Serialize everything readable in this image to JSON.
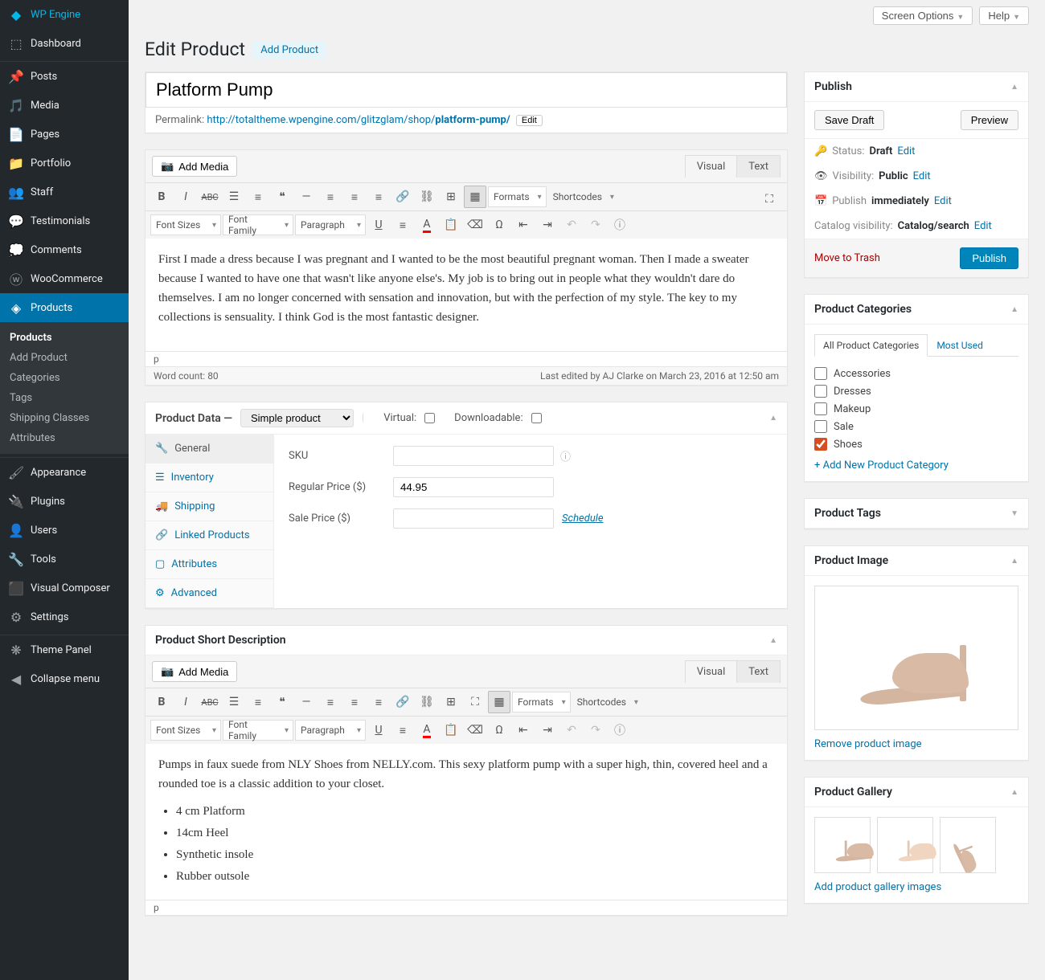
{
  "topbar": {
    "screen_options": "Screen Options",
    "help": "Help"
  },
  "page": {
    "title": "Edit Product",
    "action": "Add Product"
  },
  "sidebar": {
    "items": [
      {
        "label": "WP Engine",
        "icon": "wpengine"
      },
      {
        "label": "Dashboard",
        "icon": "dashboard"
      },
      {
        "sep": true
      },
      {
        "label": "Posts",
        "icon": "pin"
      },
      {
        "label": "Media",
        "icon": "media"
      },
      {
        "label": "Pages",
        "icon": "page"
      },
      {
        "label": "Portfolio",
        "icon": "portfolio"
      },
      {
        "label": "Staff",
        "icon": "staff"
      },
      {
        "label": "Testimonials",
        "icon": "chat"
      },
      {
        "label": "Comments",
        "icon": "comment"
      },
      {
        "label": "WooCommerce",
        "icon": "woo"
      },
      {
        "label": "Products",
        "icon": "products",
        "active": true
      },
      {
        "sep": true
      },
      {
        "label": "Appearance",
        "icon": "brush"
      },
      {
        "label": "Plugins",
        "icon": "plug"
      },
      {
        "label": "Users",
        "icon": "user"
      },
      {
        "label": "Tools",
        "icon": "tools"
      },
      {
        "label": "Visual Composer",
        "icon": "vc"
      },
      {
        "label": "Settings",
        "icon": "settings"
      },
      {
        "sep": true
      },
      {
        "label": "Theme Panel",
        "icon": "gear"
      },
      {
        "label": "Collapse menu",
        "icon": "collapse"
      }
    ],
    "submenu": [
      "Products",
      "Add Product",
      "Categories",
      "Tags",
      "Shipping Classes",
      "Attributes"
    ]
  },
  "product": {
    "title": "Platform Pump",
    "permalink_label": "Permalink:",
    "permalink_base": "http://totaltheme.wpengine.com/glitzglam/shop/",
    "permalink_slug": "platform-pump/",
    "edit": "Edit"
  },
  "editor": {
    "add_media": "Add Media",
    "tabs": {
      "visual": "Visual",
      "text": "Text"
    },
    "toolbar": {
      "formats": "Formats",
      "shortcodes": "Shortcodes",
      "font_sizes": "Font Sizes",
      "font_family": "Font Family",
      "paragraph": "Paragraph"
    },
    "body": "First I made a dress because I was pregnant and I wanted to be the most beautiful pregnant woman. Then I made a sweater because I wanted to have one that wasn't like anyone else's. My job is to bring out in people what they wouldn't dare do themselves. I am no longer concerned with sensation and innovation, but with the perfection of my style. The key to my collections is sensuality. I think God is the most fantastic designer.",
    "path": "p",
    "word_count_label": "Word count: ",
    "word_count": "80",
    "last_edited": "Last edited by AJ Clarke on March 23, 2016 at 12:50 am"
  },
  "product_data": {
    "heading": "Product Data —",
    "type": "Simple product",
    "virtual": "Virtual:",
    "downloadable": "Downloadable:",
    "tabs": [
      "General",
      "Inventory",
      "Shipping",
      "Linked Products",
      "Attributes",
      "Advanced"
    ],
    "fields": {
      "sku": "SKU",
      "sku_value": "",
      "regular": "Regular Price ($)",
      "regular_value": "44.95",
      "sale": "Sale Price ($)",
      "sale_value": "",
      "schedule": "Schedule"
    }
  },
  "short_desc": {
    "heading": "Product Short Description",
    "intro": "Pumps in faux suede from NLY Shoes from NELLY.com. This sexy platform pump with a super high, thin, covered heel and a rounded toe is a classic addition to your closet.",
    "bullets": [
      "4 cm Platform",
      "14cm Heel",
      "Synthetic insole",
      "Rubber outsole"
    ],
    "path": "p"
  },
  "publish": {
    "heading": "Publish",
    "save_draft": "Save Draft",
    "preview": "Preview",
    "status_label": "Status:",
    "status": "Draft",
    "visibility_label": "Visibility:",
    "visibility": "Public",
    "publish_label": "Publish",
    "publish_val": "immediately",
    "catalog_label": "Catalog visibility:",
    "catalog": "Catalog/search",
    "edit": "Edit",
    "trash": "Move to Trash",
    "submit": "Publish"
  },
  "categories": {
    "heading": "Product Categories",
    "tab_all": "All Product Categories",
    "tab_used": "Most Used",
    "items": [
      {
        "label": "Accessories",
        "checked": false
      },
      {
        "label": "Dresses",
        "checked": false
      },
      {
        "label": "Makeup",
        "checked": false
      },
      {
        "label": "Sale",
        "checked": false
      },
      {
        "label": "Shoes",
        "checked": true
      }
    ],
    "add": "+ Add New Product Category"
  },
  "tags": {
    "heading": "Product Tags"
  },
  "image": {
    "heading": "Product Image",
    "remove": "Remove product image"
  },
  "gallery": {
    "heading": "Product Gallery",
    "add": "Add product gallery images"
  }
}
